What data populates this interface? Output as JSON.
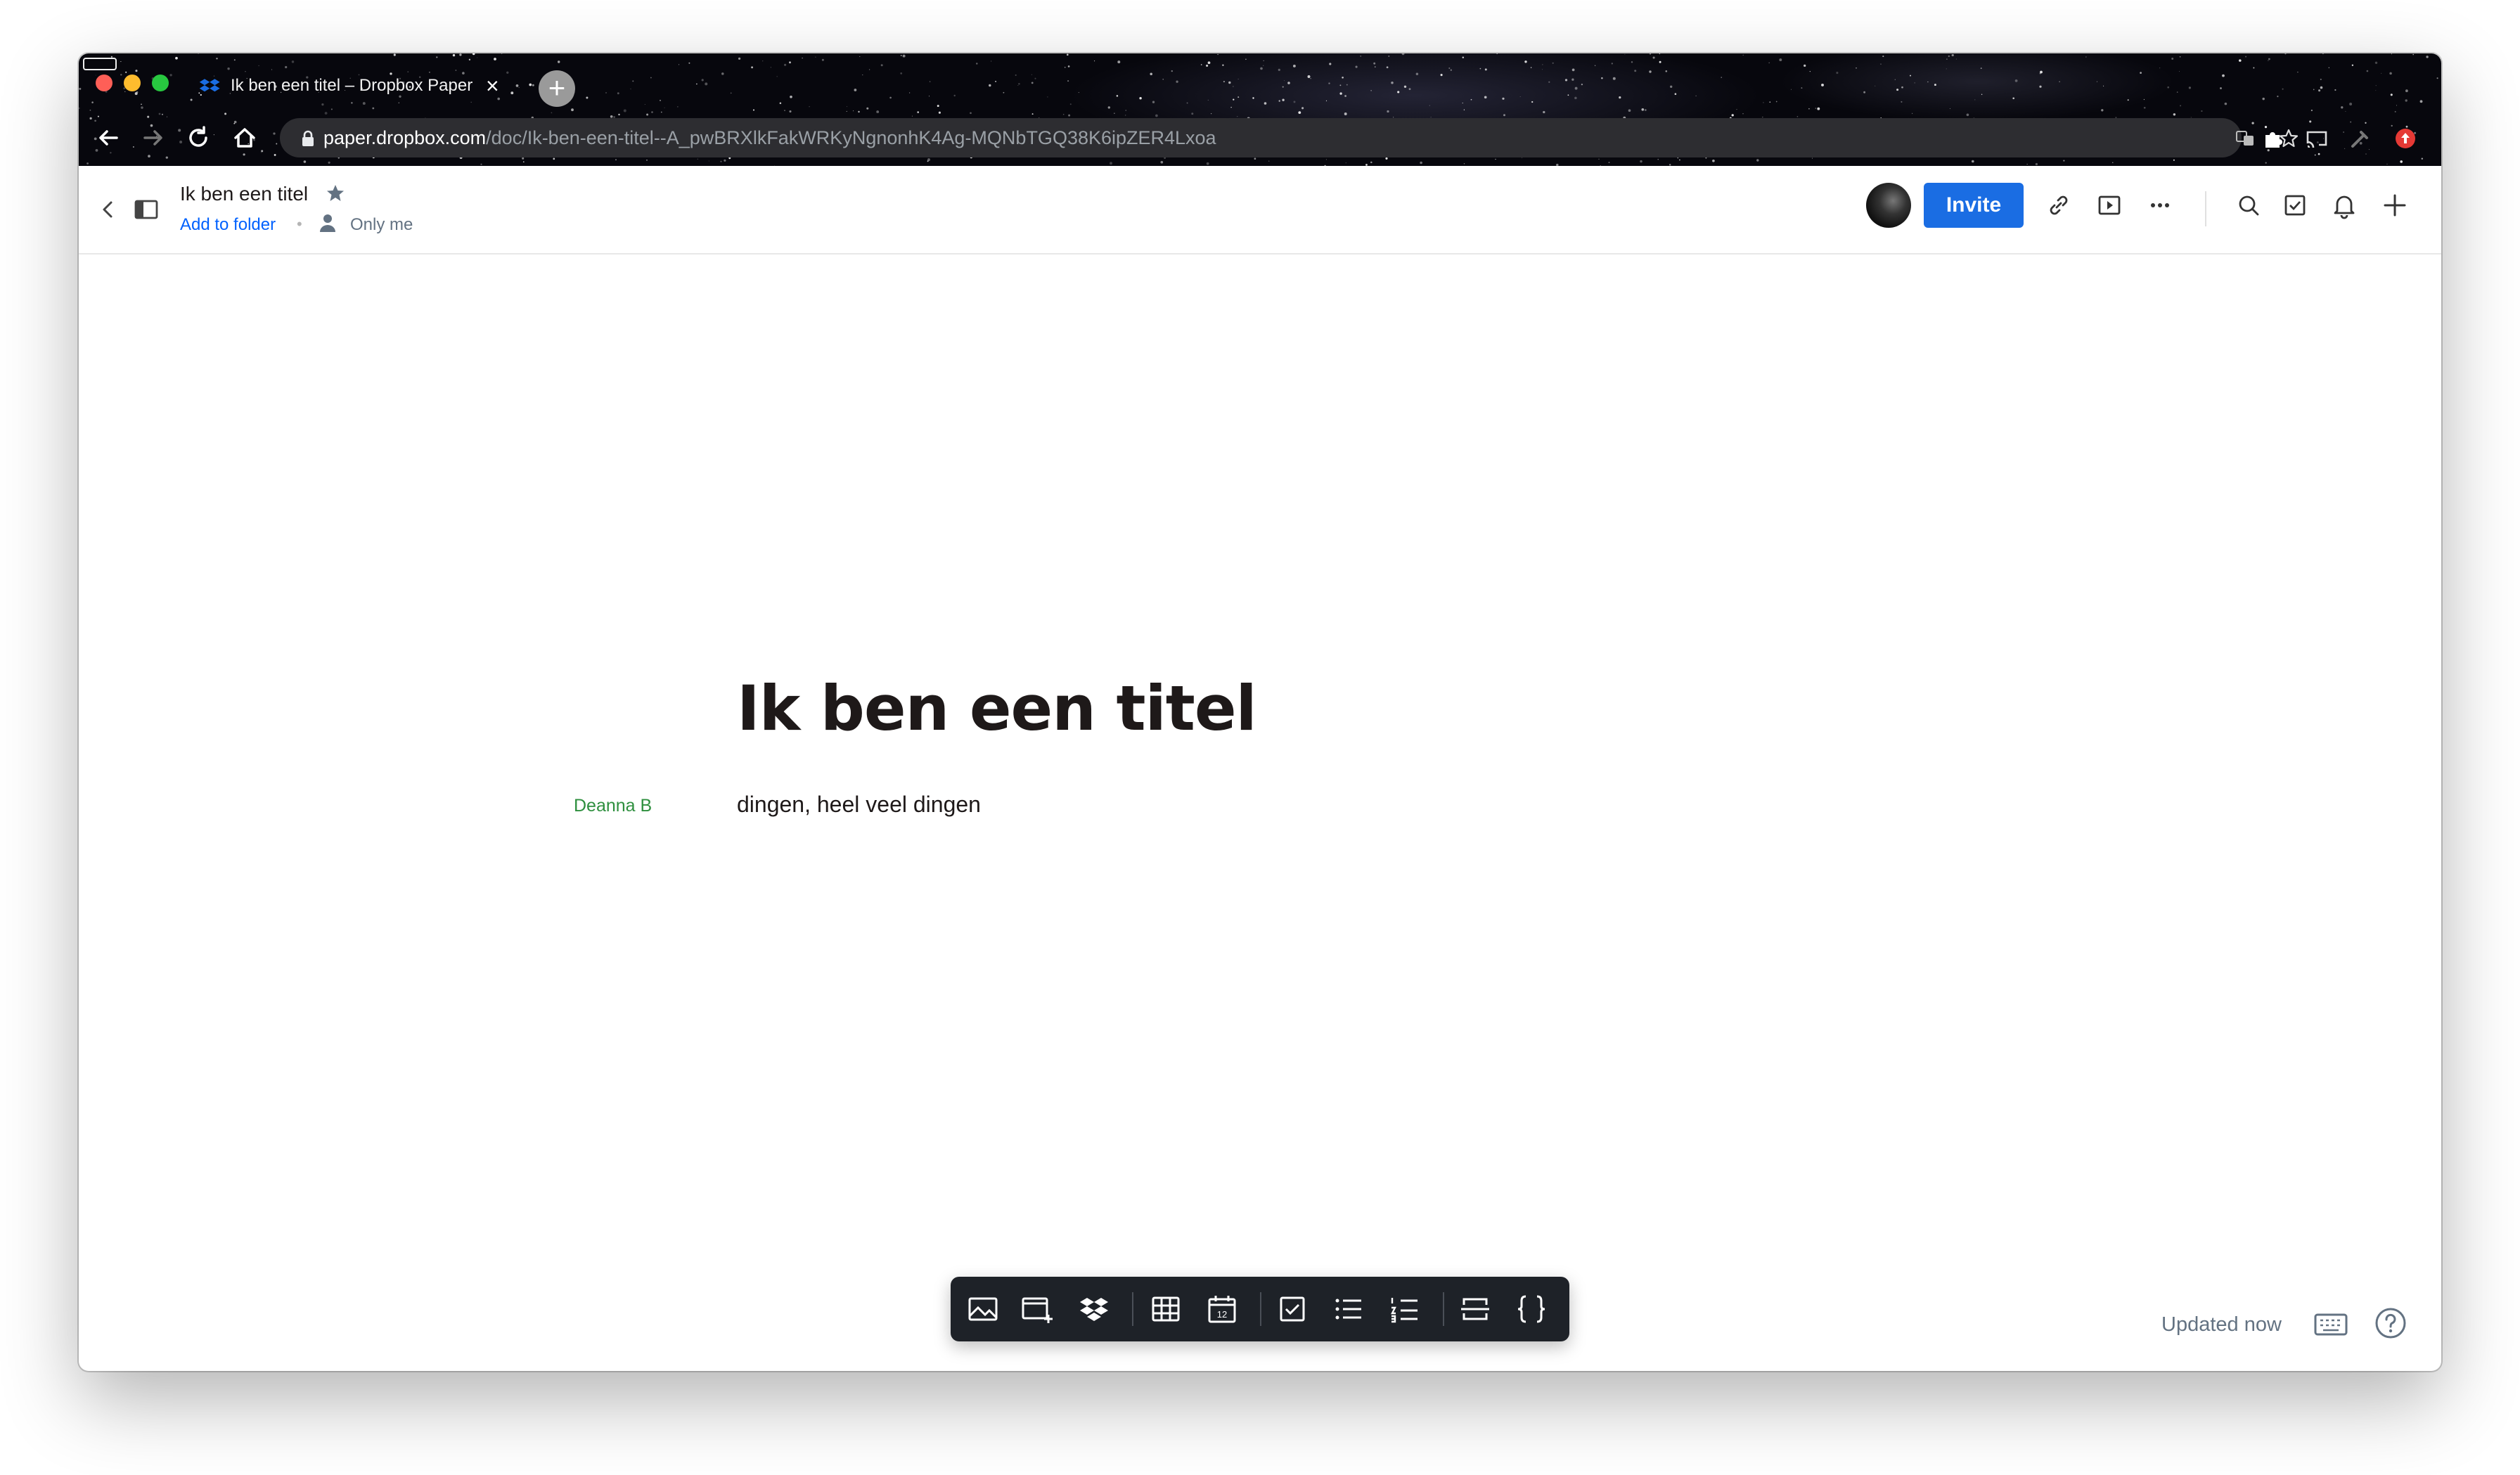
{
  "browser": {
    "tab_title": "Ik ben een titel – Dropbox Paper",
    "url_host": "paper.dropbox.com",
    "url_path": "/doc/Ik-ben-een-titel--A_pwBRXlkFakWRKyNgnonhK4Ag-MQNbTGQ38K6ipZER4Lxoa"
  },
  "header": {
    "doc_title": "Ik ben een titel",
    "add_to_folder": "Add to folder",
    "share_status": "Only me",
    "invite_label": "Invite"
  },
  "document": {
    "title": "Ik ben een titel",
    "author": "Deanna B",
    "paragraph": "dingen, heel veel dingen"
  },
  "footer": {
    "updated": "Updated now"
  },
  "colors": {
    "accent": "#1a6de3",
    "author": "#2e8f3e",
    "toolbar_bg": "#1e2228"
  }
}
